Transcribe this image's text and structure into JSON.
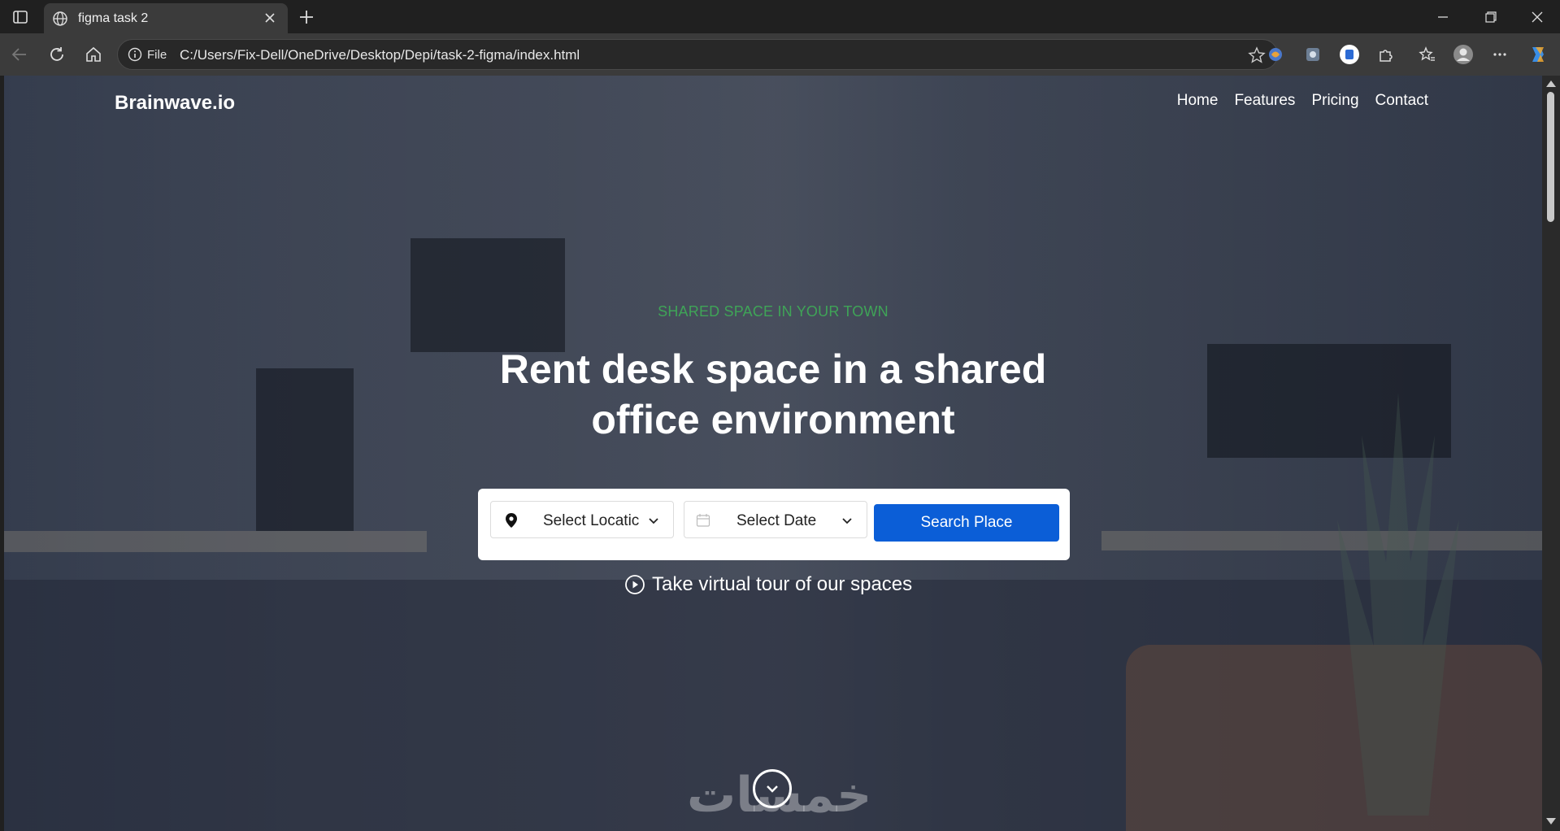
{
  "browser": {
    "tab": {
      "title": "figma task 2",
      "icon": "globe-icon"
    },
    "address": {
      "scheme_label": "File",
      "url": "C:/Users/Fix-Dell/OneDrive/Desktop/Depi/task-2-figma/index.html"
    },
    "toolbar_icons": [
      "back-icon",
      "reload-icon",
      "home-icon",
      "star-icon",
      "extension-icon",
      "collections-icon",
      "profile-icon",
      "menu-icon",
      "copilot-icon"
    ]
  },
  "site": {
    "brand": "Brainwave.io",
    "nav": [
      {
        "label": "Home"
      },
      {
        "label": "Features"
      },
      {
        "label": "Pricing"
      },
      {
        "label": "Contact"
      }
    ],
    "hero": {
      "eyebrow": "SHARED SPACE IN YOUR TOWN",
      "headline_line1": "Rent desk space in a shared",
      "headline_line2": "office environment",
      "search": {
        "location_label": "Select Locatic",
        "date_label": "Select Date",
        "button_label": "Search Place"
      },
      "tour_label": "Take virtual tour of our spaces"
    },
    "watermark": "خمسات"
  },
  "colors": {
    "accent_green": "#3fa457",
    "primary_blue": "#0b5ed7",
    "overlay": "#262e40"
  }
}
